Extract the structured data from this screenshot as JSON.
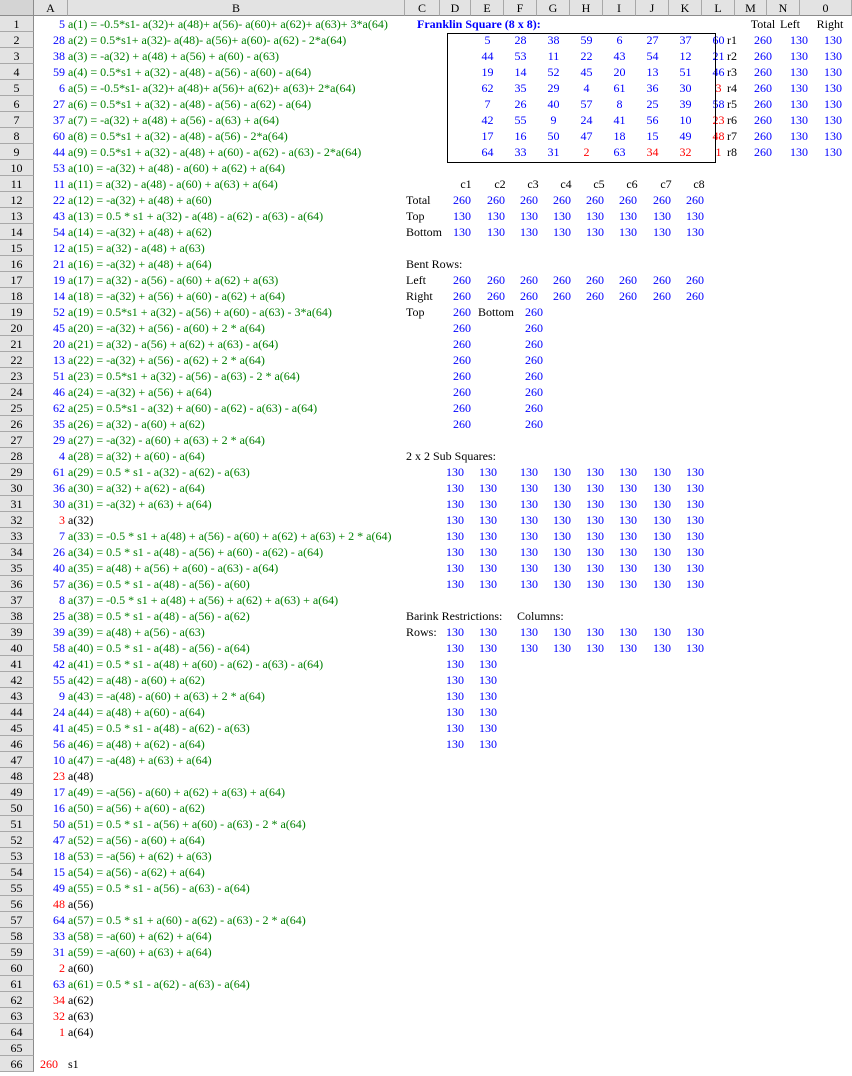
{
  "columns": [
    "A",
    "B",
    "C",
    "D",
    "E",
    "F",
    "G",
    "H",
    "I",
    "J",
    "K",
    "L",
    "M",
    "N",
    "0"
  ],
  "rows": [
    "1",
    "2",
    "3",
    "4",
    "5",
    "6",
    "7",
    "8",
    "9",
    "10",
    "11",
    "12",
    "13",
    "14",
    "15",
    "16",
    "17",
    "18",
    "19",
    "20",
    "21",
    "22",
    "23",
    "24",
    "25",
    "26",
    "27",
    "28",
    "29",
    "30",
    "31",
    "32",
    "33",
    "34",
    "35",
    "36",
    "37",
    "38",
    "39",
    "40",
    "41",
    "42",
    "43",
    "44",
    "45",
    "46",
    "47",
    "48",
    "49",
    "50",
    "51",
    "52",
    "53",
    "54",
    "55",
    "56",
    "57",
    "58",
    "59",
    "60",
    "61",
    "62",
    "63",
    "64",
    "65",
    "66"
  ],
  "formulas": [
    {
      "v": "5",
      "f": "a(1) = -0.5*s1- a(32)+ a(48)+ a(56)- a(60)+ a(62)+ a(63)+ 3*a(64)"
    },
    {
      "v": "28",
      "f": "a(2) = 0.5*s1+ a(32)- a(48)- a(56)+ a(60)- a(62) - 2*a(64)"
    },
    {
      "v": "38",
      "f": "a(3) = -a(32) + a(48) + a(56) + a(60) - a(63)"
    },
    {
      "v": "59",
      "f": "a(4) = 0.5*s1 + a(32) - a(48) - a(56) - a(60) - a(64)"
    },
    {
      "v": "6",
      "f": "a(5) = -0.5*s1- a(32)+ a(48)+ a(56)+ a(62)+ a(63)+ 2*a(64)"
    },
    {
      "v": "27",
      "f": "a(6) = 0.5*s1 + a(32) - a(48) - a(56) - a(62) - a(64)"
    },
    {
      "v": "37",
      "f": "a(7) = -a(32) + a(48) + a(56) - a(63) + a(64)"
    },
    {
      "v": "60",
      "f": "a(8) = 0.5*s1 + a(32) - a(48) - a(56) - 2*a(64)"
    },
    {
      "v": "44",
      "f": "a(9) = 0.5*s1 + a(32) - a(48) + a(60) - a(62) - a(63) - 2*a(64)"
    },
    {
      "v": "53",
      "f": "a(10) = -a(32) + a(48) - a(60) + a(62) + a(64)"
    },
    {
      "v": "11",
      "f": "a(11) = a(32) - a(48) - a(60) + a(63) + a(64)"
    },
    {
      "v": "22",
      "f": "a(12) = -a(32) + a(48) + a(60)"
    },
    {
      "v": "43",
      "f": "a(13) = 0.5 * s1 + a(32) - a(48) - a(62) - a(63) - a(64)"
    },
    {
      "v": "54",
      "f": "a(14) = -a(32) + a(48) + a(62)"
    },
    {
      "v": "12",
      "f": "a(15) = a(32) - a(48) + a(63)"
    },
    {
      "v": "21",
      "f": "a(16) = -a(32) + a(48) + a(64)"
    },
    {
      "v": "19",
      "f": "a(17) = a(32) - a(56) - a(60) + a(62) + a(63)"
    },
    {
      "v": "14",
      "f": "a(18) = -a(32) + a(56) + a(60) - a(62) + a(64)"
    },
    {
      "v": "52",
      "f": "a(19) = 0.5*s1 + a(32) - a(56) + a(60) - a(63) - 3*a(64)"
    },
    {
      "v": "45",
      "f": "a(20) = -a(32) + a(56) - a(60) + 2 * a(64)"
    },
    {
      "v": "20",
      "f": "a(21) = a(32) - a(56) + a(62) + a(63) - a(64)"
    },
    {
      "v": "13",
      "f": "a(22) = -a(32) + a(56) - a(62) + 2 * a(64)"
    },
    {
      "v": "51",
      "f": "a(23) = 0.5*s1 + a(32) - a(56) - a(63) - 2 * a(64)"
    },
    {
      "v": "46",
      "f": "a(24) = -a(32) + a(56) + a(64)"
    },
    {
      "v": "62",
      "f": "a(25) = 0.5*s1 - a(32) + a(60) - a(62) - a(63) - a(64)"
    },
    {
      "v": "35",
      "f": "a(26) = a(32) - a(60) + a(62)"
    },
    {
      "v": "29",
      "f": "a(27) = -a(32) - a(60) + a(63) + 2 * a(64)"
    },
    {
      "v": "4",
      "f": "a(28) = a(32) + a(60) - a(64)"
    },
    {
      "v": "61",
      "f": "a(29) = 0.5 * s1 - a(32) - a(62) - a(63)"
    },
    {
      "v": "36",
      "f": "a(30) = a(32) + a(62) - a(64)"
    },
    {
      "v": "30",
      "f": "a(31) = -a(32) + a(63) + a(64)"
    },
    {
      "v": "3",
      "f": "a(32)",
      "red": true
    },
    {
      "v": "7",
      "f": "a(33) = -0.5 * s1 + a(48) + a(56) - a(60) + a(62) + a(63) + 2 * a(64)"
    },
    {
      "v": "26",
      "f": "a(34) = 0.5 * s1 - a(48) - a(56) + a(60) - a(62) - a(64)"
    },
    {
      "v": "40",
      "f": "a(35) = a(48) + a(56) + a(60) - a(63) - a(64)"
    },
    {
      "v": "57",
      "f": "a(36) = 0.5 * s1 - a(48) - a(56) - a(60)"
    },
    {
      "v": "8",
      "f": "a(37) = -0.5 * s1 + a(48) + a(56) + a(62) + a(63) + a(64)"
    },
    {
      "v": "25",
      "f": "a(38) = 0.5 * s1 - a(48) - a(56) - a(62)"
    },
    {
      "v": "39",
      "f": "a(39) = a(48) + a(56) - a(63)"
    },
    {
      "v": "58",
      "f": "a(40) = 0.5 * s1 - a(48) - a(56) - a(64)"
    },
    {
      "v": "42",
      "f": "a(41) = 0.5 * s1 - a(48) + a(60) - a(62) - a(63) - a(64)"
    },
    {
      "v": "55",
      "f": "a(42) = a(48) - a(60) + a(62)"
    },
    {
      "v": "9",
      "f": "a(43) = -a(48) - a(60) + a(63) + 2 * a(64)"
    },
    {
      "v": "24",
      "f": "a(44) = a(48) + a(60) - a(64)"
    },
    {
      "v": "41",
      "f": "a(45) = 0.5 * s1 - a(48) - a(62) - a(63)"
    },
    {
      "v": "56",
      "f": "a(46) = a(48) + a(62) - a(64)"
    },
    {
      "v": "10",
      "f": "a(47) = -a(48) + a(63) + a(64)"
    },
    {
      "v": "23",
      "f": "a(48)",
      "red": true
    },
    {
      "v": "17",
      "f": "a(49) = -a(56) - a(60) + a(62) + a(63) + a(64)"
    },
    {
      "v": "16",
      "f": "a(50) = a(56) + a(60) - a(62)"
    },
    {
      "v": "50",
      "f": "a(51) = 0.5 * s1 - a(56) + a(60) - a(63) - 2 * a(64)"
    },
    {
      "v": "47",
      "f": "a(52) = a(56) - a(60) + a(64)"
    },
    {
      "v": "18",
      "f": "a(53) = -a(56) + a(62) + a(63)"
    },
    {
      "v": "15",
      "f": "a(54) = a(56) - a(62) + a(64)"
    },
    {
      "v": "49",
      "f": "a(55) = 0.5 * s1 - a(56) - a(63) - a(64)"
    },
    {
      "v": "48",
      "f": "a(56)",
      "red": true
    },
    {
      "v": "64",
      "f": "a(57) = 0.5 * s1 + a(60) - a(62) - a(63) - 2 * a(64)"
    },
    {
      "v": "33",
      "f": "a(58) = -a(60) + a(62) + a(64)"
    },
    {
      "v": "31",
      "f": "a(59) = -a(60) + a(63) + a(64)"
    },
    {
      "v": "2",
      "f": "a(60)",
      "red": true
    },
    {
      "v": "63",
      "f": "a(61) = 0.5 * s1 - a(62) - a(63) - a(64)"
    },
    {
      "v": "34",
      "f": "a(62)",
      "red": true
    },
    {
      "v": "32",
      "f": "a(63)",
      "red": true
    },
    {
      "v": "1",
      "f": "a(64)",
      "red": true
    }
  ],
  "s1": {
    "v": "260",
    "label": "s1"
  },
  "franklin": {
    "title": "Franklin Square (8 x 8):",
    "grid": [
      [
        "5",
        "28",
        "38",
        "59",
        "6",
        "27",
        "37",
        "60"
      ],
      [
        "44",
        "53",
        "11",
        "22",
        "43",
        "54",
        "12",
        "21"
      ],
      [
        "19",
        "14",
        "52",
        "45",
        "20",
        "13",
        "51",
        "46"
      ],
      [
        "62",
        "35",
        "29",
        "4",
        "61",
        "36",
        "30",
        "3"
      ],
      [
        "7",
        "26",
        "40",
        "57",
        "8",
        "25",
        "39",
        "58"
      ],
      [
        "42",
        "55",
        "9",
        "24",
        "41",
        "56",
        "10",
        "23"
      ],
      [
        "17",
        "16",
        "50",
        "47",
        "18",
        "15",
        "49",
        "48"
      ],
      [
        "64",
        "33",
        "31",
        "2",
        "63",
        "34",
        "32",
        "1"
      ]
    ],
    "red_cells": [
      "3,7",
      "5,7",
      "6,7",
      "7,3",
      "7,5",
      "7,6",
      "7,7"
    ]
  },
  "row_sums": {
    "headers": [
      "Total",
      "Left",
      "Right"
    ],
    "labels": [
      "r1",
      "r2",
      "r3",
      "r4",
      "r5",
      "r6",
      "r7",
      "r8"
    ],
    "values": [
      [
        "260",
        "130",
        "130"
      ],
      [
        "260",
        "130",
        "130"
      ],
      [
        "260",
        "130",
        "130"
      ],
      [
        "260",
        "130",
        "130"
      ],
      [
        "260",
        "130",
        "130"
      ],
      [
        "260",
        "130",
        "130"
      ],
      [
        "260",
        "130",
        "130"
      ],
      [
        "260",
        "130",
        "130"
      ]
    ]
  },
  "col_sums": {
    "headers": [
      "c1",
      "c2",
      "c3",
      "c4",
      "c5",
      "c6",
      "c7",
      "c8"
    ],
    "rows": [
      {
        "label": "Total",
        "values": [
          "260",
          "260",
          "260",
          "260",
          "260",
          "260",
          "260",
          "260"
        ]
      },
      {
        "label": "Top",
        "values": [
          "130",
          "130",
          "130",
          "130",
          "130",
          "130",
          "130",
          "130"
        ]
      },
      {
        "label": "Bottom",
        "values": [
          "130",
          "130",
          "130",
          "130",
          "130",
          "130",
          "130",
          "130"
        ]
      }
    ]
  },
  "bent": {
    "title": "Bent Rows:",
    "rows": [
      {
        "label": "Left",
        "values": [
          "260",
          "260",
          "260",
          "260",
          "260",
          "260",
          "260",
          "260"
        ]
      },
      {
        "label": "Right",
        "values": [
          "260",
          "260",
          "260",
          "260",
          "260",
          "260",
          "260",
          "260"
        ]
      }
    ],
    "top_label": "Top",
    "bottom_label": "Bottom",
    "top_values": [
      "260",
      "260",
      "260",
      "260",
      "260",
      "260",
      "260",
      "260"
    ],
    "bottom_values": [
      "260",
      "260",
      "260",
      "260",
      "260",
      "260",
      "260",
      "260"
    ]
  },
  "subsquares": {
    "title": "2 x 2 Sub Squares:",
    "rows": [
      [
        "130",
        "130",
        "130",
        "130",
        "130",
        "130",
        "130",
        "130"
      ],
      [
        "130",
        "130",
        "130",
        "130",
        "130",
        "130",
        "130",
        "130"
      ],
      [
        "130",
        "130",
        "130",
        "130",
        "130",
        "130",
        "130",
        "130"
      ],
      [
        "130",
        "130",
        "130",
        "130",
        "130",
        "130",
        "130",
        "130"
      ],
      [
        "130",
        "130",
        "130",
        "130",
        "130",
        "130",
        "130",
        "130"
      ],
      [
        "130",
        "130",
        "130",
        "130",
        "130",
        "130",
        "130",
        "130"
      ],
      [
        "130",
        "130",
        "130",
        "130",
        "130",
        "130",
        "130",
        "130"
      ],
      [
        "130",
        "130",
        "130",
        "130",
        "130",
        "130",
        "130",
        "130"
      ]
    ]
  },
  "barink": {
    "title": "Barink Restrictions:",
    "columns_label": "Columns:",
    "rows_label": "Rows:",
    "rows": [
      [
        "130",
        "130"
      ],
      [
        "130",
        "130"
      ],
      [
        "130",
        "130"
      ],
      [
        "130",
        "130"
      ],
      [
        "130",
        "130"
      ],
      [
        "130",
        "130"
      ],
      [
        "130",
        "130"
      ],
      [
        "130",
        "130"
      ]
    ],
    "columns": [
      [
        "130",
        "130",
        "130",
        "130",
        "130",
        "130"
      ],
      [
        "130",
        "130",
        "130",
        "130",
        "130",
        "130"
      ]
    ]
  }
}
